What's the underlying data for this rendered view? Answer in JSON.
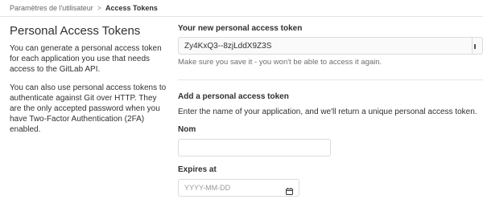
{
  "breadcrumb": {
    "parent": "Paramètres de l'utilisateur",
    "separator": ">",
    "current": "Access Tokens"
  },
  "sidebar": {
    "title": "Personal Access Tokens",
    "paragraph1": "You can generate a personal access token for each application you use that needs access to the GitLab API.",
    "paragraph2": "You can also use personal access tokens to authenticate against Git over HTTP. They are the only accepted password when you have Two-Factor Authentication (2FA) enabled."
  },
  "new_token": {
    "label": "Your new personal access token",
    "value": "Zy4KxQ3--8zjLddX9Z3S",
    "help": "Make sure you save it - you won't be able to access it again."
  },
  "add_token": {
    "heading": "Add a personal access token",
    "description": "Enter the name of your application, and we'll return a unique personal access token.",
    "name_label": "Nom",
    "name_value": "",
    "expires_label": "Expires at",
    "expires_placeholder": "YYYY-MM-DD"
  },
  "icons": {
    "copy": "copy-icon",
    "calendar": "calendar-icon"
  }
}
